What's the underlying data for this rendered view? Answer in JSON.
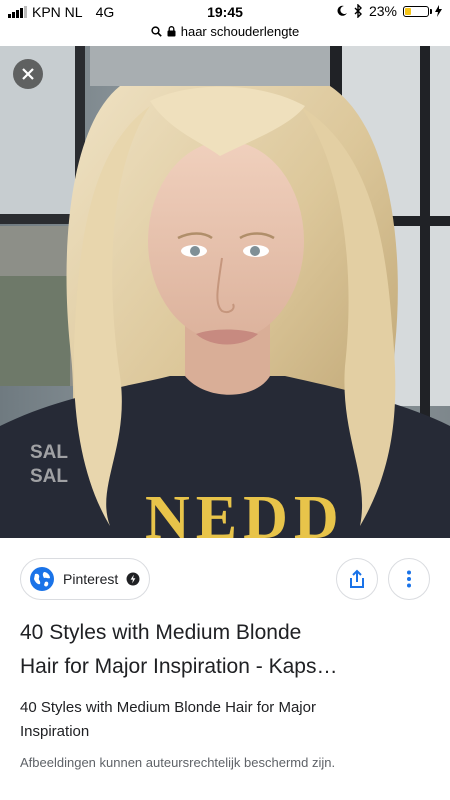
{
  "status_bar": {
    "carrier": "KPN NL",
    "network": "4G",
    "time": "19:45",
    "battery_percent": "23%",
    "battery_level": 0.23
  },
  "url_bar": {
    "query": "haar schouderlengte"
  },
  "image_viewer": {
    "close_icon": "close-icon",
    "watermark_lines": [
      "SAL",
      "SAL"
    ],
    "shirt_text": "NEDD"
  },
  "source": {
    "name": "Pinterest",
    "icon": "globe-icon"
  },
  "actions": {
    "share_icon": "share-icon",
    "more_icon": "more-vert-icon"
  },
  "result": {
    "title_line1": "40 Styles with Medium Blonde",
    "title_line2": "Hair for Major Inspiration - Kaps…",
    "subtitle_line1": "40 Styles with Medium Blonde Hair for Major",
    "subtitle_line2": "Inspiration",
    "copyright": "Afbeeldingen kunnen auteursrechtelijk beschermd zijn."
  },
  "colors": {
    "accent_blue": "#1a73e8",
    "battery_yellow": "#f5c518",
    "text": "#202124",
    "muted": "#5f6368"
  }
}
